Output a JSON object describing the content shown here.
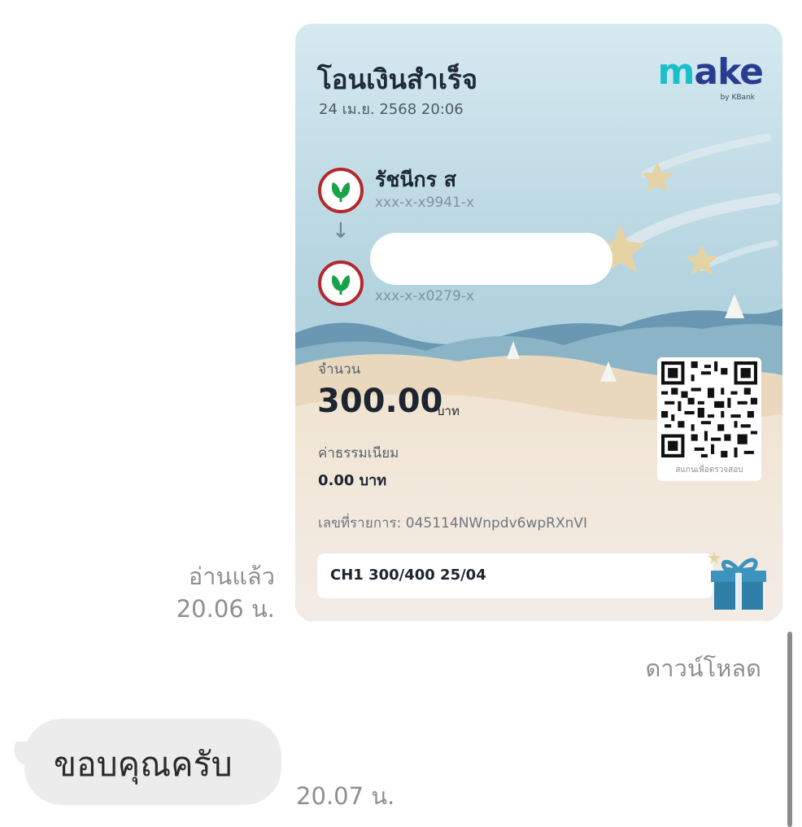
{
  "sent_message": {
    "read_status": "อ่านแล้ว",
    "time": "20.06 น.",
    "download_label": "ดาวน์โหลด"
  },
  "slip": {
    "title": "โอนเงินสำเร็จ",
    "datetime": "24 เม.ย. 2568 20:06",
    "brand": {
      "name_part1": "m",
      "name_part2": "ake",
      "sub": "by KBank"
    },
    "sender": {
      "name": "รัชนีกร ส",
      "account": "xxx-x-x9941-x"
    },
    "receiver": {
      "name": "",
      "account": "xxx-x-x0279-x"
    },
    "amount_label": "จำนวน",
    "amount_value": "300.00",
    "amount_unit": "บาท",
    "fee_label": "ค่าธรรมเนียม",
    "fee_value": "0.00 บาท",
    "reference": "เลขที่รายการ: 045114NWnpdv6wpRXnVI",
    "qr_caption": "สแกนเพื่อตรวจสอบ",
    "memo": "CH1 300/400 25/04",
    "colors": {
      "bank_ring": "#b3282d",
      "bank_leaf": "#1aa24b",
      "brand_teal": "#19c0c9"
    }
  },
  "incoming_message": {
    "text": "ขอบคุณครับ",
    "time": "20.07 น."
  },
  "icons": [
    "kbank-logo-icon",
    "down-arrow-icon",
    "qr-code-icon",
    "gift-box-icon"
  ]
}
